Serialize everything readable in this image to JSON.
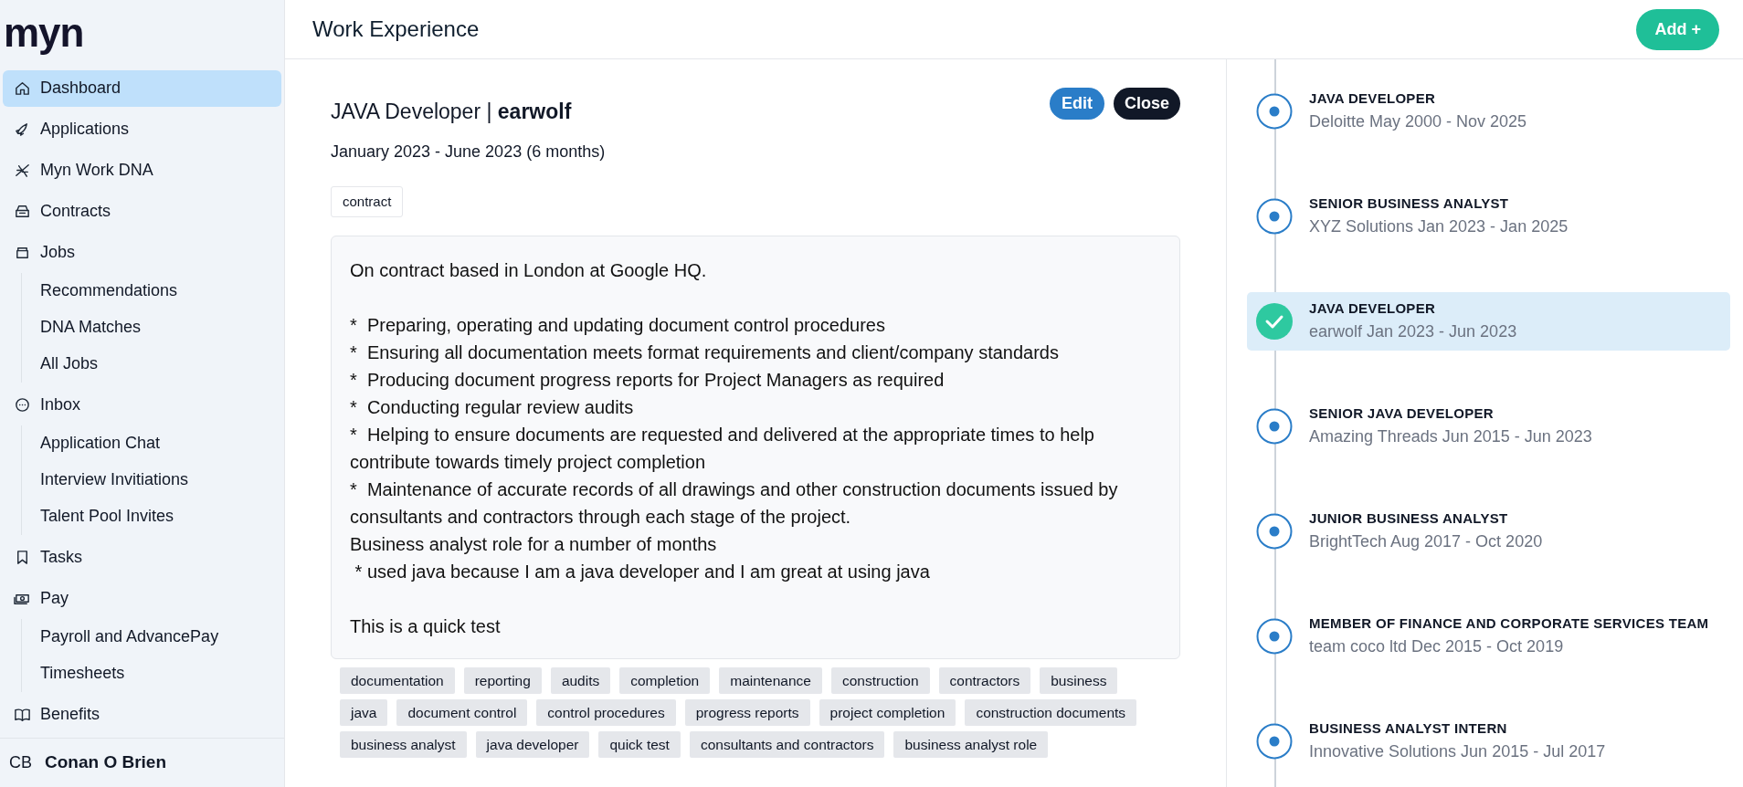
{
  "logo": "myn",
  "sidebar": {
    "items": [
      {
        "label": "Dashboard",
        "selected": true
      },
      {
        "label": "Applications",
        "selected": false
      },
      {
        "label": "Myn Work DNA",
        "selected": false
      },
      {
        "label": "Contracts",
        "selected": false
      },
      {
        "label": "Jobs",
        "selected": false,
        "children": [
          {
            "label": "Recommendations"
          },
          {
            "label": "DNA Matches"
          },
          {
            "label": "All Jobs"
          }
        ]
      },
      {
        "label": "Inbox",
        "selected": false,
        "children": [
          {
            "label": "Application Chat"
          },
          {
            "label": "Interview Invitiations"
          },
          {
            "label": "Talent Pool Invites"
          }
        ]
      },
      {
        "label": "Tasks",
        "selected": false
      },
      {
        "label": "Pay",
        "selected": false,
        "children": [
          {
            "label": "Payroll and AdvancePay"
          },
          {
            "label": "Timesheets"
          }
        ]
      },
      {
        "label": "Benefits",
        "selected": false
      }
    ],
    "user": {
      "initials": "CB",
      "name": "Conan O Brien"
    }
  },
  "header": {
    "title": "Work Experience",
    "add_button": "Add +"
  },
  "detail": {
    "title": "JAVA Developer | **earwolf**",
    "dates": "January 2023 - June 2023 (6 months)",
    "buttons": {
      "edit": "Edit",
      "close": "Close"
    },
    "type_tag": "contract",
    "description": "On contract based in London at Google HQ.\n\n*  Preparing, operating and updating document control procedures\n*  Ensuring all documentation meets format requirements and client/company standards\n*  Producing document progress reports for Project Managers as required\n*  Conducting regular review audits\n*  Helping to ensure documents are requested and delivered at the appropriate times to help contribute towards timely project completion\n*  Maintenance of accurate records of all drawings and other construction documents issued by consultants and contractors through each stage of the project.\nBusiness analyst role for a number of months\n * used java because I am a java developer and I am great at using java\n\nThis is a quick test",
    "keywords": [
      "documentation",
      "reporting",
      "audits",
      "completion",
      "maintenance",
      "construction",
      "contractors",
      "business",
      "java",
      "document control",
      "control procedures",
      "progress reports",
      "project completion",
      "construction documents",
      "business analyst",
      "java developer",
      "quick test",
      "consultants and contractors",
      "business analyst role"
    ]
  },
  "timeline": [
    {
      "title": "JAVA DEVELOPER",
      "subtitle": "Deloitte May 2000 - Nov 2025",
      "selected": false
    },
    {
      "title": "SENIOR BUSINESS ANALYST",
      "subtitle": "XYZ Solutions Jan 2023 - Jan 2025",
      "selected": false
    },
    {
      "title": "JAVA DEVELOPER",
      "subtitle": "earwolf Jan 2023 - Jun 2023",
      "selected": true
    },
    {
      "title": "SENIOR JAVA DEVELOPER",
      "subtitle": "Amazing Threads Jun 2015 - Jun 2023",
      "selected": false
    },
    {
      "title": "JUNIOR BUSINESS ANALYST",
      "subtitle": "BrightTech Aug 2017 - Oct 2020",
      "selected": false
    },
    {
      "title": "MEMBER OF FINANCE AND CORPORATE SERVICES TEAM",
      "subtitle": "team coco ltd Dec 2015 - Oct 2019",
      "selected": false
    },
    {
      "title": "BUSINESS ANALYST INTERN",
      "subtitle": "Innovative Solutions Jun 2015 - Jul 2017",
      "selected": false
    }
  ]
}
